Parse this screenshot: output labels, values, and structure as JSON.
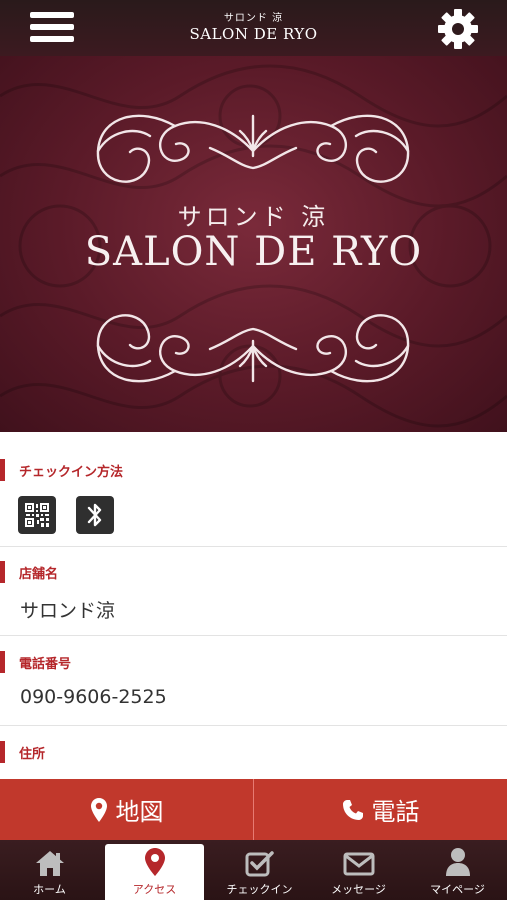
{
  "header": {
    "brand_small": "サロンド 涼",
    "brand_big": "SALON DE RYO",
    "menu_icon": "hamburger-menu-icon",
    "settings_icon": "gear-icon"
  },
  "hero": {
    "name_jp": "サロンド 涼",
    "name_en": "SALON DE RYO"
  },
  "sections": {
    "checkin": {
      "label": "チェックイン方法",
      "icons": [
        "qr-code-icon",
        "bluetooth-icon"
      ]
    },
    "shop": {
      "label": "店舗名",
      "value": "サロンド涼"
    },
    "phone": {
      "label": "電話番号",
      "value": "090-9606-2525"
    },
    "address": {
      "label": "住所"
    }
  },
  "actions": {
    "map_label": "地図",
    "call_label": "電話"
  },
  "tabs": [
    {
      "label": "ホーム",
      "icon": "home-icon"
    },
    {
      "label": "アクセス",
      "icon": "map-pin-icon",
      "active": true
    },
    {
      "label": "チェックイン",
      "icon": "checkbox-icon"
    },
    {
      "label": "メッセージ",
      "icon": "envelope-icon"
    },
    {
      "label": "マイページ",
      "icon": "user-icon"
    }
  ],
  "colors": {
    "accent": "#b5272b",
    "action": "#c1382c",
    "header": "#2a1a1b",
    "hero": "#5a1a28"
  }
}
